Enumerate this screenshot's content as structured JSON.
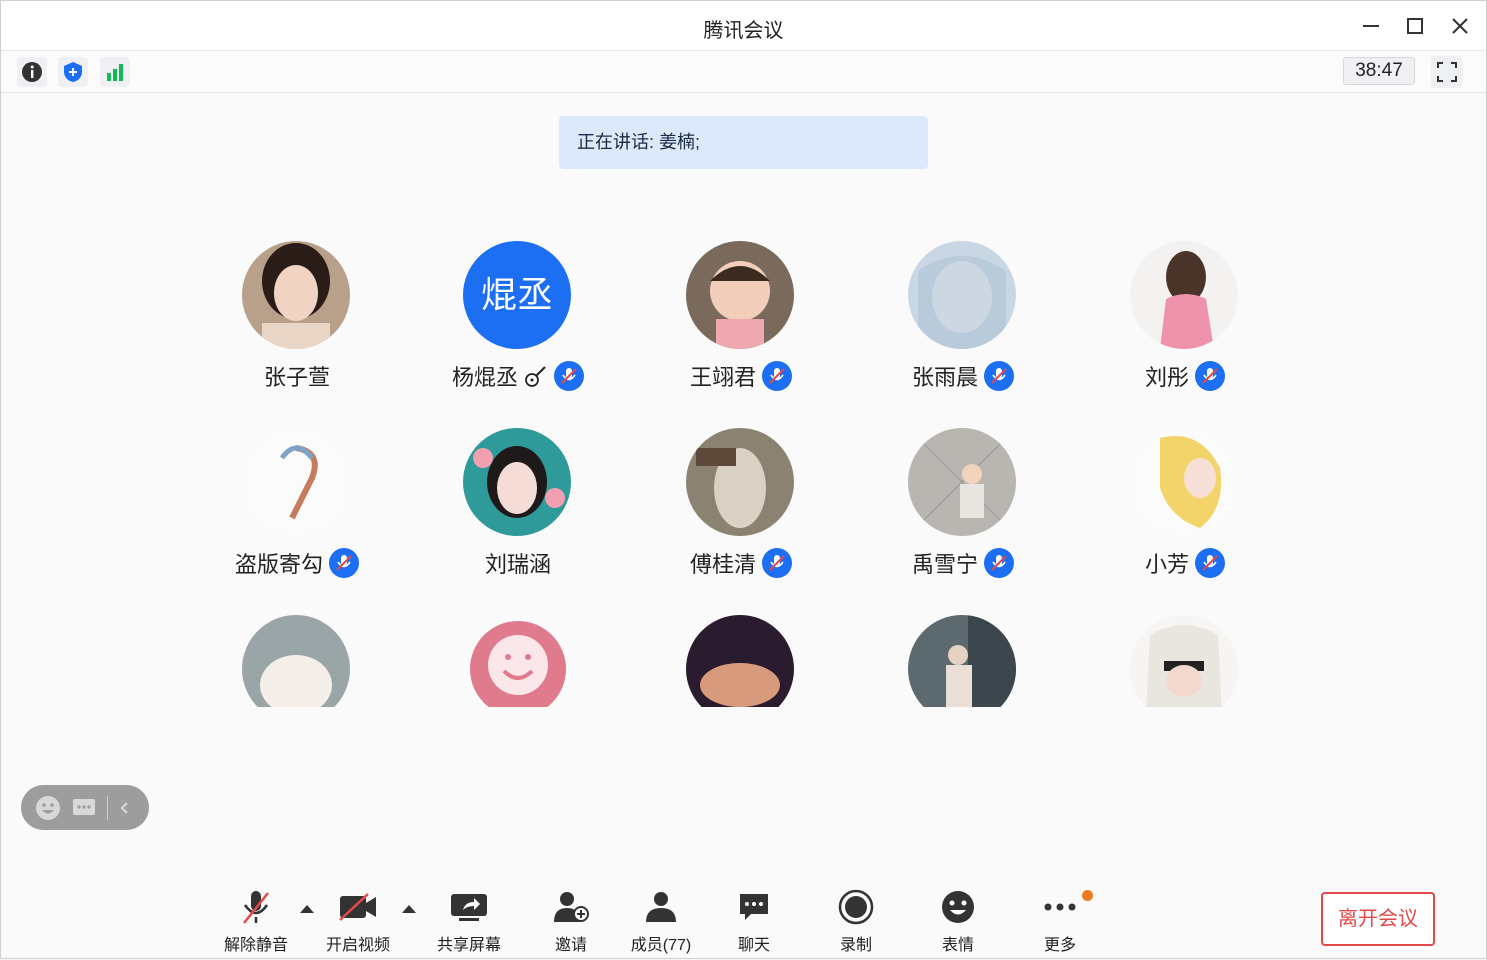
{
  "window": {
    "title": "腾讯会议",
    "timer": "38:47"
  },
  "speaking": {
    "text": "正在讲话: 姜楠;"
  },
  "participants": [
    {
      "name": "张子萱",
      "muted": false,
      "avatar": "photo"
    },
    {
      "name": "杨焜丞",
      "muted": true,
      "avatar_text": "焜丞",
      "avatar_color": "#1c6ef2",
      "extra_icon": "guitar-icon"
    },
    {
      "name": "王翊君",
      "muted": true,
      "avatar": "photo"
    },
    {
      "name": "张雨晨",
      "muted": true,
      "avatar": "photo"
    },
    {
      "name": "刘彤",
      "muted": true,
      "avatar": "photo"
    },
    {
      "name": "盗版寄勾",
      "muted": true,
      "avatar": "photo"
    },
    {
      "name": "刘瑞涵",
      "muted": false,
      "avatar": "photo"
    },
    {
      "name": "傅桂清",
      "muted": true,
      "avatar": "photo"
    },
    {
      "name": "禹雪宁",
      "muted": true,
      "avatar": "photo"
    },
    {
      "name": "小芳",
      "muted": true,
      "avatar": "photo"
    }
  ],
  "bottombar": {
    "unmute": "解除静音",
    "video": "开启视频",
    "share": "共享屏幕",
    "invite": "邀请",
    "members": "成员(77)",
    "chat": "聊天",
    "record": "录制",
    "emoji": "表情",
    "more": "更多",
    "leave": "离开会议"
  },
  "colors": {
    "accent": "#1c6ef2",
    "leave": "#e24a4a",
    "notice": "#f07a1a",
    "speaking_bg": "#dce9fb"
  }
}
